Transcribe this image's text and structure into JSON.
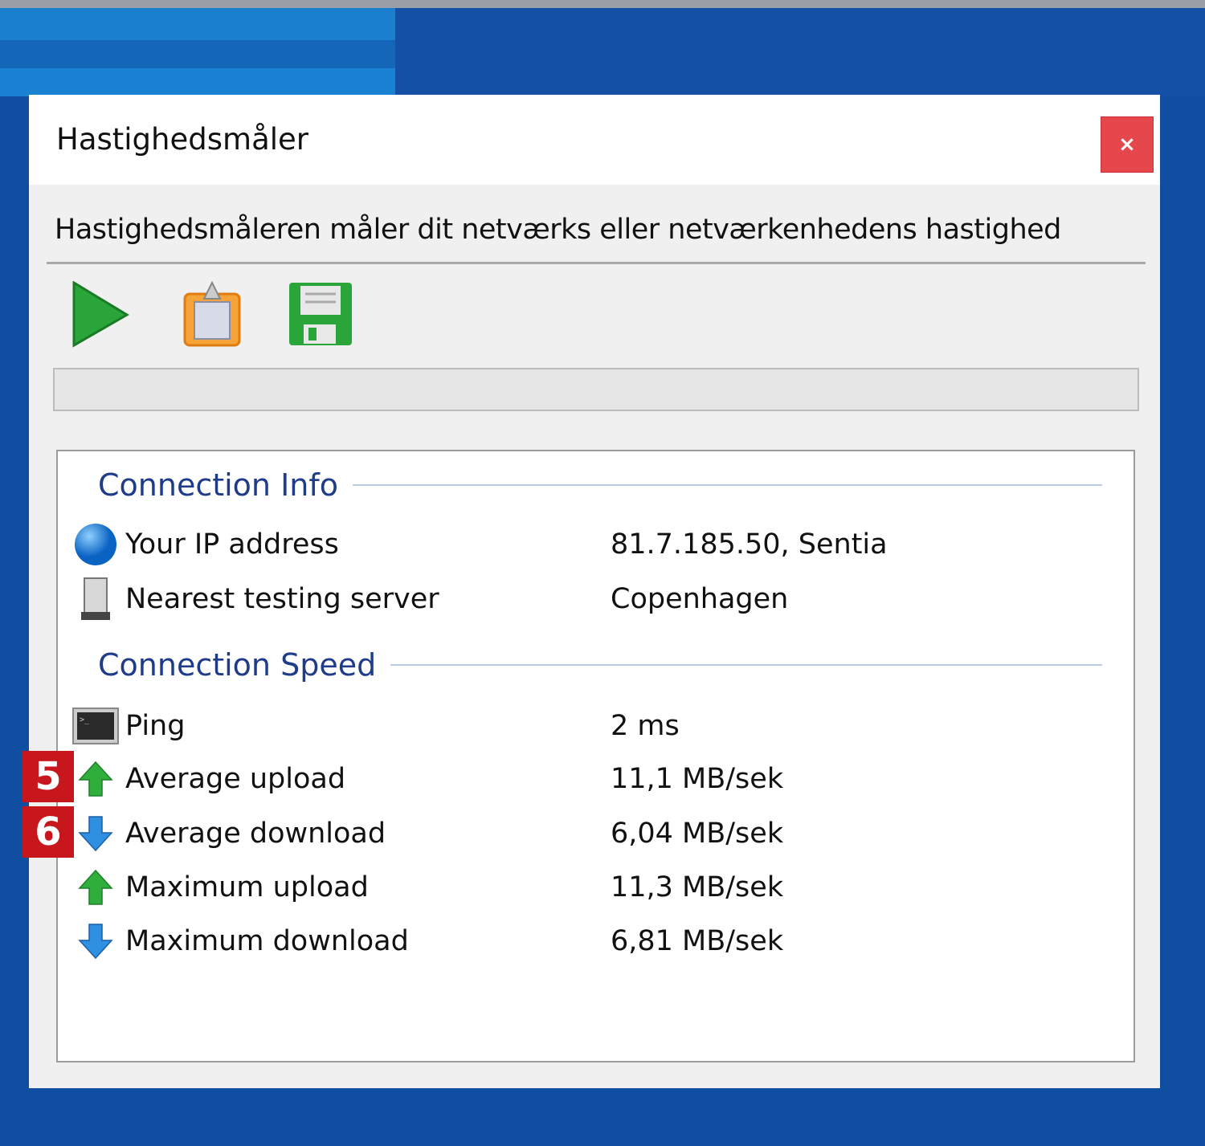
{
  "window": {
    "title": "Hastighedsmåler",
    "close_label": "×",
    "description": "Hastighedsmåleren måler dit netværks eller netværkenhedens hastighed"
  },
  "toolbar": [
    {
      "icon": "play-icon"
    },
    {
      "icon": "clipboard-icon"
    },
    {
      "icon": "save-icon"
    }
  ],
  "progress": 0,
  "connection_info": {
    "heading": "Connection Info",
    "rows": [
      {
        "label": "Your IP address",
        "value": "81.7.185.50, Sentia",
        "icon": "globe-icon"
      },
      {
        "label": "Nearest testing server",
        "value": "Copenhagen",
        "icon": "server-icon"
      }
    ]
  },
  "connection_speed": {
    "heading": "Connection Speed",
    "rows": [
      {
        "label": "Ping",
        "value": "2 ms",
        "icon": "terminal-icon"
      },
      {
        "label": "Average upload",
        "value": "11,1 MB/sek",
        "icon": "upload-arrow-icon",
        "badge": "5"
      },
      {
        "label": "Average download",
        "value": "6,04 MB/sek",
        "icon": "download-arrow-icon",
        "badge": "6"
      },
      {
        "label": "Maximum upload",
        "value": "11,3 MB/sek",
        "icon": "upload-arrow-icon"
      },
      {
        "label": "Maximum download",
        "value": "6,81 MB/sek",
        "icon": "download-arrow-icon"
      }
    ]
  }
}
